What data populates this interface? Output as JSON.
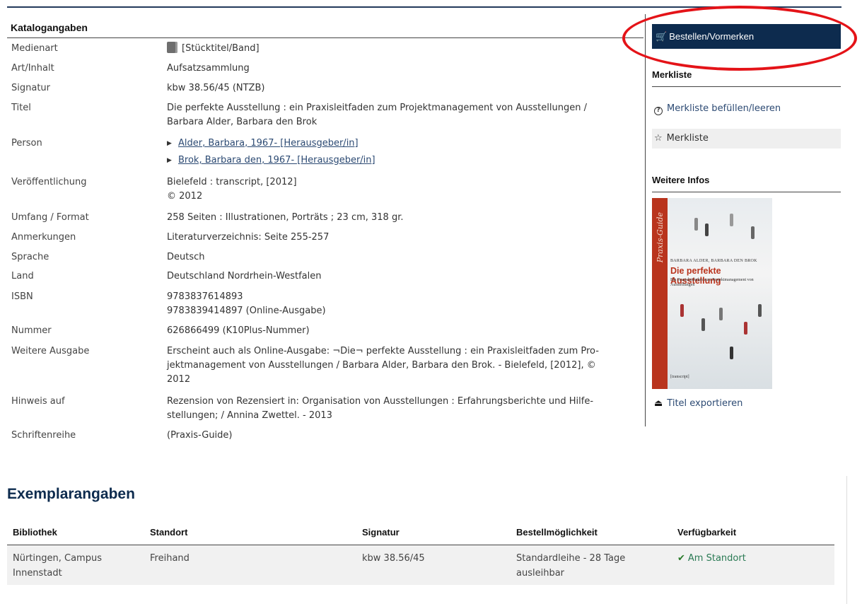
{
  "catalog": {
    "heading": "Katalogangaben",
    "medienart": {
      "label": "Medienart",
      "value": "[Stücktitel/Band]"
    },
    "art": {
      "label": "Art/Inhalt",
      "value": "Aufsatzsammlung"
    },
    "signatur": {
      "label": "Signatur",
      "value": "kbw 38.56/45 (NTZB)"
    },
    "titel": {
      "label": "Titel",
      "lines": [
        "Die perfekte Ausstellung : ein Praxisleitfaden zum Projektmanagement von Ausstellungen /",
        "Barbara Alder, Barbara den Brok"
      ]
    },
    "person": {
      "label": "Person",
      "links": [
        "Alder, Barbara, 1967- [Herausgeber/in]",
        "Brok, Barbara den, 1967- [Herausgeber/in]"
      ]
    },
    "veroeffentlichung": {
      "label": "Veröffentlichung",
      "lines": [
        "Bielefeld : transcript, [2012]",
        "© 2012"
      ]
    },
    "umfang": {
      "label": "Umfang / Format",
      "value": "258 Seiten : Illustrationen, Porträts ; 23 cm, 318 gr."
    },
    "anmerkungen": {
      "label": "Anmerkungen",
      "value": "Literaturverzeichnis: Seite 255-257"
    },
    "sprache": {
      "label": "Sprache",
      "value": "Deutsch"
    },
    "land": {
      "label": "Land",
      "value": "Deutschland Nordrhein-Westfalen"
    },
    "isbn": {
      "label": "ISBN",
      "lines": [
        "9783837614893",
        "9783839414897 (Online-Ausgabe)"
      ]
    },
    "nummer": {
      "label": "Nummer",
      "value": "626866499 (K10Plus-Nummer)"
    },
    "weitere": {
      "label": "Weitere Ausgabe",
      "lines": [
        "Erscheint auch als Online-Ausgabe: ¬Die¬ perfekte Ausstellung : ein Praxisleitfaden zum Pro-",
        "jektmanagement von Ausstellungen / Barbara Alder, Barbara den Brok. - Bielefeld, [2012], ©",
        "2012"
      ]
    },
    "hinweis": {
      "label": "Hinweis auf",
      "lines": [
        "Rezension von Rezensiert in: Organisation von Ausstellungen : Erfahrungsberichte und Hilfe-",
        "stellungen; / Annina Zwettel. - 2013"
      ]
    },
    "reihe": {
      "label": "Schriftenreihe",
      "value": "(Praxis-Guide)"
    }
  },
  "sidebar": {
    "order_button": "Bestellen/Vormerken",
    "merkliste_heading": "Merkliste",
    "merkliste_fill": "Merkliste befüllen/leeren",
    "merkliste": "Merkliste",
    "infos_heading": "Weitere Infos",
    "export": "Titel exportieren",
    "cover": {
      "series": "Praxis-Guide",
      "authors": "BARBARA ALDER, BARBARA DEN BROK",
      "title": "Die perfekte Ausstellung",
      "subtitle": "Ein Praxisleitfaden zum Projektmanagement von Ausstellungen",
      "publisher": "[transcript]"
    }
  },
  "exemplar": {
    "heading": "Exemplarangaben",
    "columns": [
      "Bibliothek",
      "Standort",
      "Signatur",
      "Bestellmöglichkeit",
      "Verfügbarkeit"
    ],
    "row": {
      "bibliothek": [
        "Nürtingen, Campus",
        "Innenstadt"
      ],
      "standort": "Freihand",
      "signatur": "kbw 38.56/45",
      "bestellung": [
        "Standardleihe - 28 Tage",
        "ausleihbar"
      ],
      "verfuegbarkeit": "Am Standort"
    }
  },
  "colors": {
    "navy": "#0d2b4e",
    "highlight": "#e41318",
    "available": "#2a7a54"
  }
}
